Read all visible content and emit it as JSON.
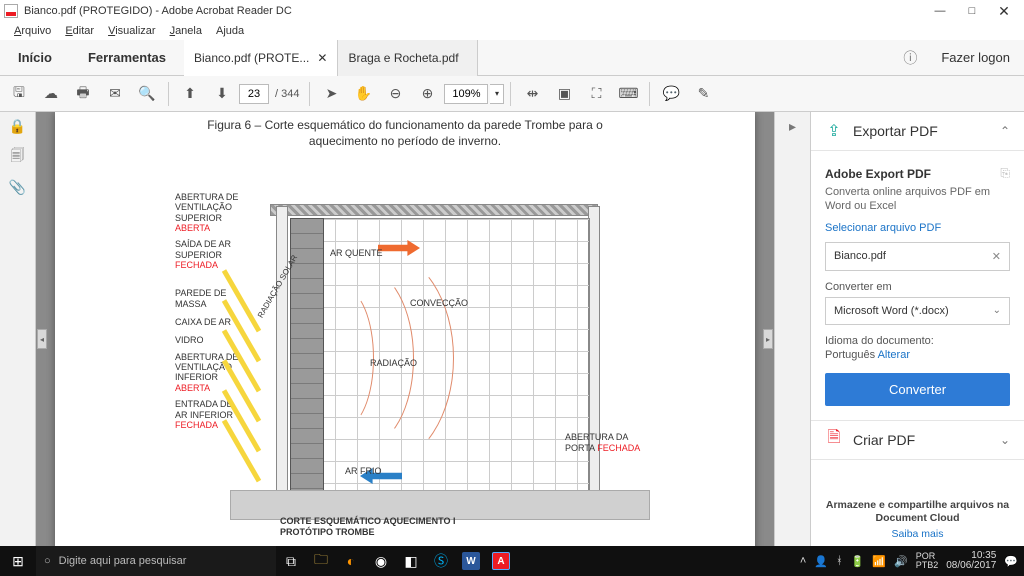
{
  "window": {
    "title": "Bianco.pdf (PROTEGIDO) - Adobe Acrobat Reader DC"
  },
  "menu": {
    "arquivo": "Arquivo",
    "editar": "Editar",
    "visualizar": "Visualizar",
    "janela": "Janela",
    "ajuda": "Ajuda"
  },
  "tabs": {
    "home": "Início",
    "tools": "Ferramentas",
    "doc1": "Bianco.pdf (PROTE...",
    "doc2": "Braga e Rocheta.pdf",
    "signin": "Fazer logon"
  },
  "toolbar": {
    "page_current": "23",
    "page_total": "/ 344",
    "zoom": "109%"
  },
  "figure": {
    "title": "Figura 6 – Corte esquemático do funcionamento da parede Trombe para o",
    "subtitle": "aquecimento no período de inverno.",
    "labels": {
      "l1a": "ABERTURA DE\nVENTILAÇÃO\nSUPERIOR",
      "l1b": "ABERTA",
      "l2a": "SAÍDA DE AR\nSUPERIOR",
      "l2b": "FECHADA",
      "l3": "PAREDE DE\nMASSA",
      "l4": "CAIXA DE AR",
      "l5": "VIDRO",
      "l6a": "ABERTURA DE\nVENTILAÇÃO\nINFERIOR",
      "l6b": "ABERTA",
      "l7a": "ENTRADA DE\nAR INFERIOR",
      "l7b": "FECHADA",
      "sun": "RADIAÇÃO\nSOLAR",
      "hot": "AR QUENTE",
      "cold": "AR FRIO",
      "conv": "CONVECÇÃO",
      "rad": "RADIAÇÃO",
      "door": "ABERTURA DA\nPORTA",
      "door_state": "FECHADA"
    },
    "caption": "CORTE ESQUEMÁTICO AQUECIMENTO I\nPROTÓTIPO TROMBE"
  },
  "panel": {
    "export_head": "Exportar PDF",
    "export_title": "Adobe Export PDF",
    "export_desc": "Converta online arquivos PDF em Word ou Excel",
    "select_file": "Selecionar arquivo PDF",
    "filename": "Bianco.pdf",
    "convert_to": "Converter em",
    "format": "Microsoft Word (*.docx)",
    "lang_label": "Idioma do documento:",
    "lang_value": "Português ",
    "lang_change": "Alterar",
    "convert_btn": "Converter",
    "create_head": "Criar PDF",
    "promo": "Armazene e compartilhe arquivos na Document Cloud",
    "learn": "Saiba mais"
  },
  "taskbar": {
    "search_placeholder": "Digite aqui para pesquisar",
    "lang": "POR\nPTB2",
    "time": "10:35",
    "date": "08/06/2017"
  }
}
